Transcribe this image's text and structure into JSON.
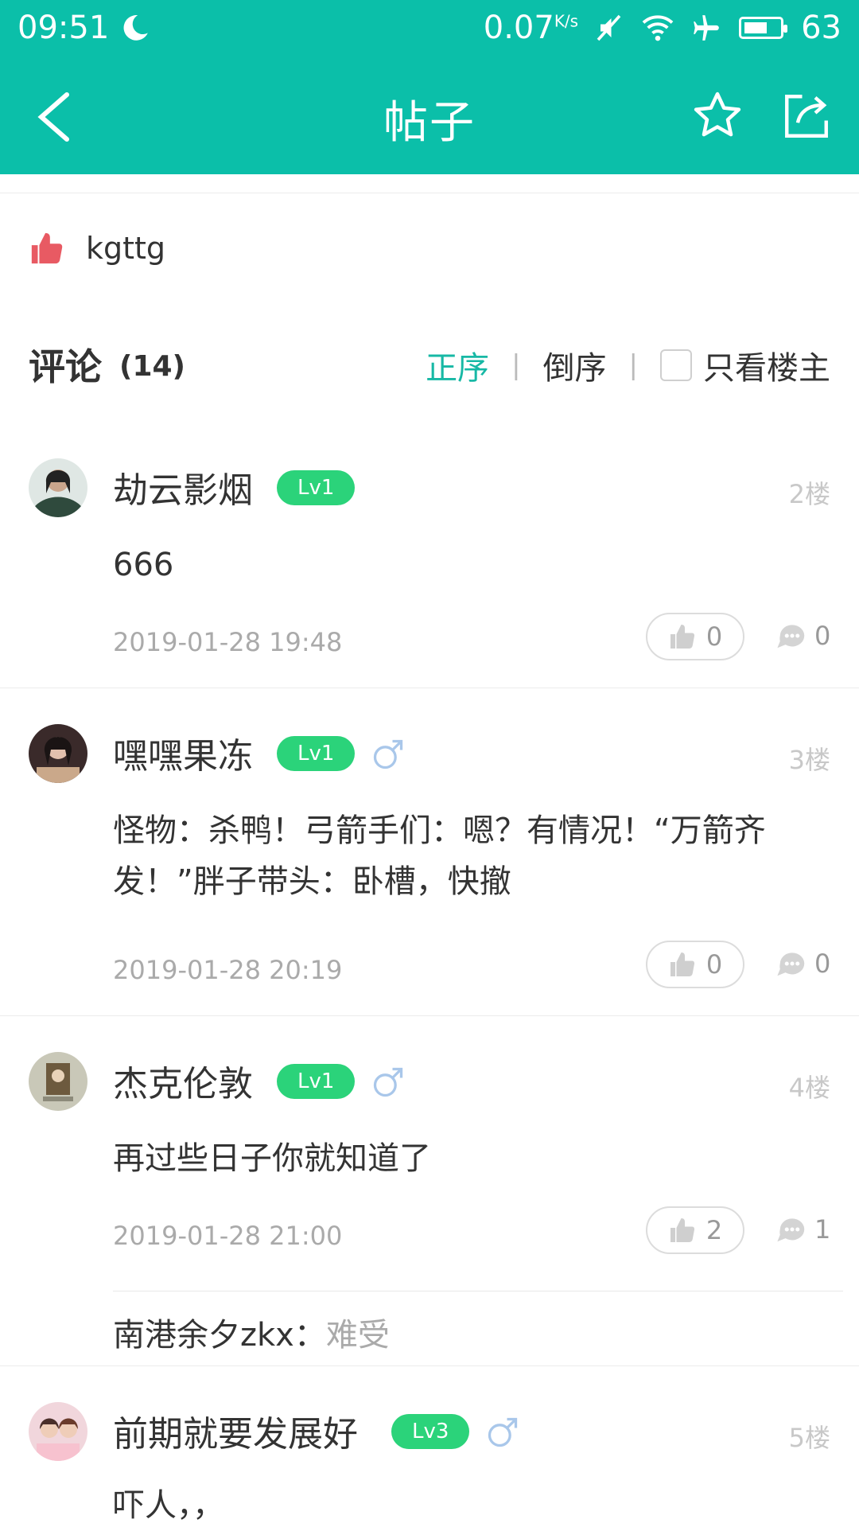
{
  "status_bar": {
    "time": "09:51",
    "speed": "0.07",
    "speed_unit": "K/s",
    "battery": "63"
  },
  "app_bar": {
    "title": "帖子"
  },
  "likes": {
    "liker": "kgttg"
  },
  "comments_header": {
    "title": "评论",
    "count": "(14)",
    "sort_asc": "正序",
    "sort_desc": "倒序",
    "only_op": "只看楼主"
  },
  "comments": [
    {
      "username": "劫云影烟",
      "level": "Lv1",
      "floor": "2楼",
      "content": "666",
      "time": "2019-01-28 19:48",
      "likes": "0",
      "replies": "0"
    },
    {
      "username": "嘿嘿果冻",
      "level": "Lv1",
      "floor": "3楼",
      "content": "怪物：杀鸭！弓箭手们：嗯？有情况！“万箭齐发！”胖子带头：卧槽，快撤",
      "time": "2019-01-28 20:19",
      "likes": "0",
      "replies": "0"
    },
    {
      "username": "杰克伦敦",
      "level": "Lv1",
      "floor": "4楼",
      "content": "再过些日子你就知道了",
      "time": "2019-01-28 21:00",
      "likes": "2",
      "replies": "1",
      "reply_user": "南港余夕zkx：",
      "reply_text": "难受"
    },
    {
      "username": "前期就要发展好",
      "level": "Lv3",
      "floor": "5楼",
      "content": "吓人，，"
    }
  ],
  "colors": {
    "accent": "#0bbfa9",
    "level_badge": "#2bd37a",
    "like_red": "#e85a63"
  }
}
